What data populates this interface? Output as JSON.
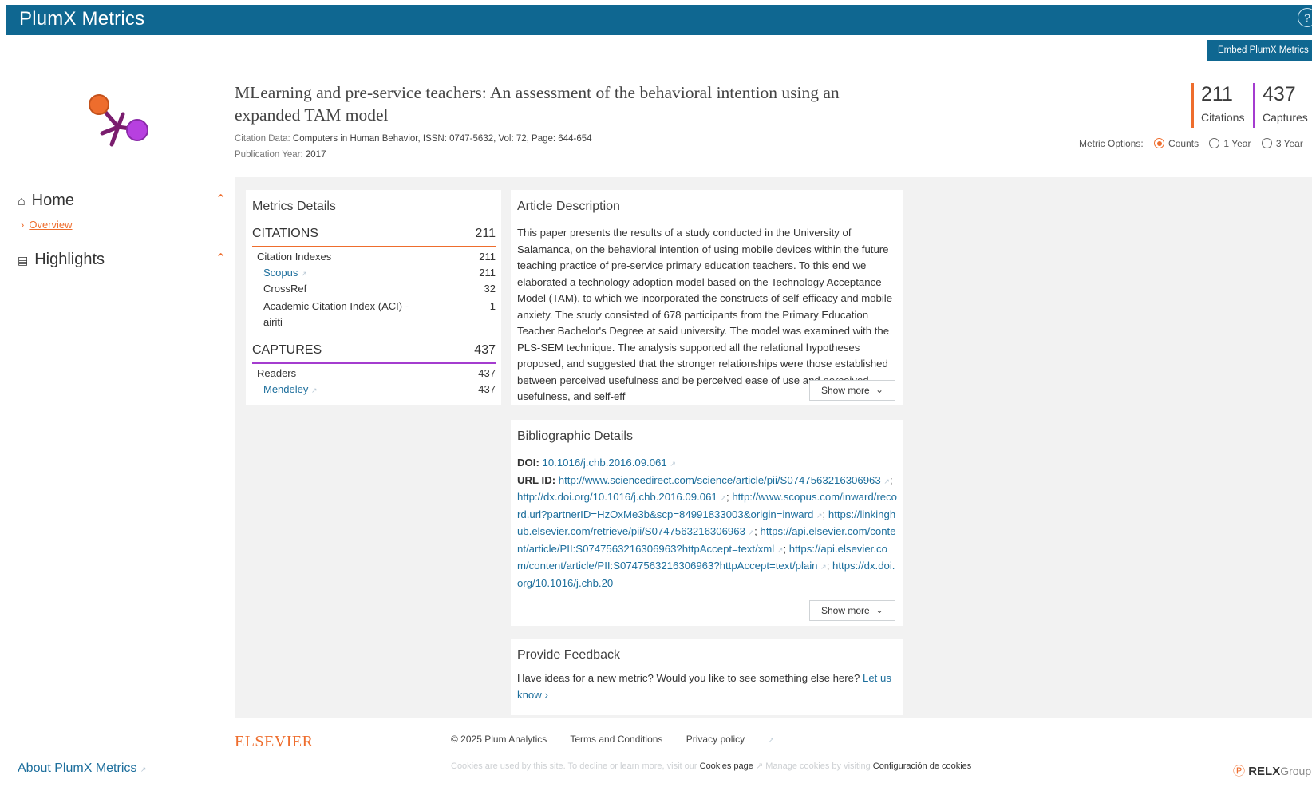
{
  "app": {
    "brand": "PlumX Metrics",
    "help_icon": "?"
  },
  "header": {
    "embed_label": "Embed PlumX Metrics"
  },
  "article": {
    "title": "MLearning and pre-service teachers: An assessment of the behavioral intention using an expanded TAM model",
    "citation_label": "Citation Data:",
    "citation_value": "Computers in Human Behavior, ISSN: 0747-5632, Vol: 72, Page: 644-654",
    "pub_label": "Publication Year:",
    "pub_value": "2017"
  },
  "summary": {
    "citations_count": "211",
    "citations_label": "Citations",
    "captures_count": "437",
    "captures_label": "Captures"
  },
  "metric_options": {
    "label": "Metric Options:",
    "options": [
      "Counts",
      "1 Year",
      "3 Year"
    ],
    "selected": "Counts"
  },
  "nav": {
    "home": "Home",
    "overview": "Overview",
    "highlights": "Highlights",
    "about": "About PlumX Metrics"
  },
  "metrics_details": {
    "title": "Metrics Details",
    "citations": {
      "label": "CITATIONS",
      "total": "211",
      "group_label": "Citation Indexes",
      "group_total": "211",
      "sources": [
        {
          "name": "Scopus",
          "count": "211"
        },
        {
          "name": "CrossRef",
          "count": "32"
        },
        {
          "name": "Academic Citation Index (ACI) -",
          "name2": "airiti",
          "count": "1"
        }
      ]
    },
    "captures": {
      "label": "CAPTURES",
      "total": "437",
      "group_label": "Readers",
      "group_total": "437",
      "sources": [
        {
          "name": "Mendeley",
          "count": "437"
        }
      ]
    }
  },
  "article_description": {
    "title": "Article Description",
    "text": "This paper presents the results of a study conducted in the University of Salamanca, on the behavioral intention of using mobile devices within the future teaching practice of pre-service primary education teachers. To this end we elaborated a technology adoption model based on the Technology Acceptance Model (TAM), to which we incorporated the constructs of self-efficacy and mobile anxiety. The study consisted of 678 participants from the Primary Education Teacher Bachelor's Degree at said university. The model was examined with the PLS-SEM technique. The analysis supported all the relational hypotheses proposed, and suggested that the stronger relationships were those established between perceived usefulness and be perceived ease of use and perceived usefulness, and self-eff",
    "show_more": "Show more"
  },
  "bibliographic": {
    "title": "Bibliographic Details",
    "doi_label": "DOI:",
    "doi": "10.1016/j.chb.2016.09.061",
    "url_label": "URL ID:",
    "urls": [
      "http://www.sciencedirect.com/science/article/pii/S0747563216306963",
      "http://dx.doi.org/10.1016/j.chb.2016.09.061",
      "http://www.scopus.com/inward/record.url?partnerID=HzOxMe3b&scp=84991833003&origin=inward",
      "https://linkinghub.elsevier.com/retrieve/pii/S0747563216306963",
      "https://api.elsevier.com/content/article/PII:S0747563216306963?httpAccept=text/xml",
      "https://api.elsevier.com/content/article/PII:S0747563216306963?httpAccept=text/plain",
      "https://dx.doi.org/10.1016/j.chb.20"
    ],
    "show_more": "Show more"
  },
  "feedback": {
    "title": "Provide Feedback",
    "text": "Have ideas for a new metric? Would you like to see something else here?",
    "link": "Let us know"
  },
  "footer": {
    "elsevier": "ELSEVIER",
    "copyright": "© 2025 Plum Analytics",
    "terms": "Terms and Conditions",
    "privacy": "Privacy policy",
    "cookie_text": "Cookies are used by this site. To decline or learn more, visit our",
    "cookie_page": "Cookies page",
    "cookie_manage": "Manage cookies by visiting",
    "cookie_config": "Configuración de cookies",
    "relx": "RELX",
    "group": "Group"
  },
  "colors": {
    "brand": "#0f6791",
    "citations": "#ee6d2d",
    "captures": "#a43ccf",
    "link": "#1c6e9c"
  }
}
